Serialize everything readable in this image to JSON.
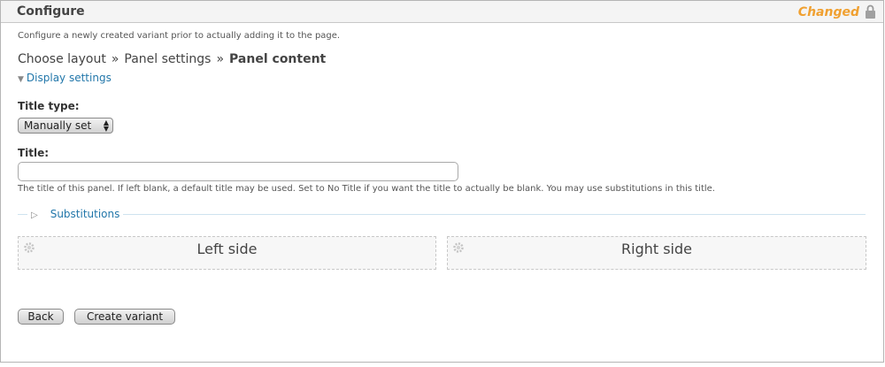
{
  "header": {
    "title": "Configure",
    "status": "Changed"
  },
  "description": "Configure a newly created variant prior to actually adding it to the page.",
  "breadcrumb": {
    "steps": [
      "Choose layout",
      "Panel settings",
      "Panel content"
    ],
    "separator": "»"
  },
  "display_settings": {
    "label": "Display settings",
    "icon": "triangle-down-icon"
  },
  "form": {
    "title_type": {
      "label": "Title type:",
      "value": "Manually set"
    },
    "title": {
      "label": "Title:",
      "value": "",
      "help": "The title of this panel. If left blank, a default title may be used. Set to No Title if you want the title to actually be blank. You may use substitutions in this title."
    },
    "substitutions": {
      "label": "Substitutions",
      "icon": "triangle-right-icon"
    }
  },
  "regions": [
    {
      "title": "Left side",
      "icon": "gear-icon"
    },
    {
      "title": "Right side",
      "icon": "gear-icon"
    }
  ],
  "buttons": {
    "back": "Back",
    "create": "Create variant"
  },
  "colors": {
    "accent_link": "#2277aa",
    "changed": "#f0a030"
  }
}
